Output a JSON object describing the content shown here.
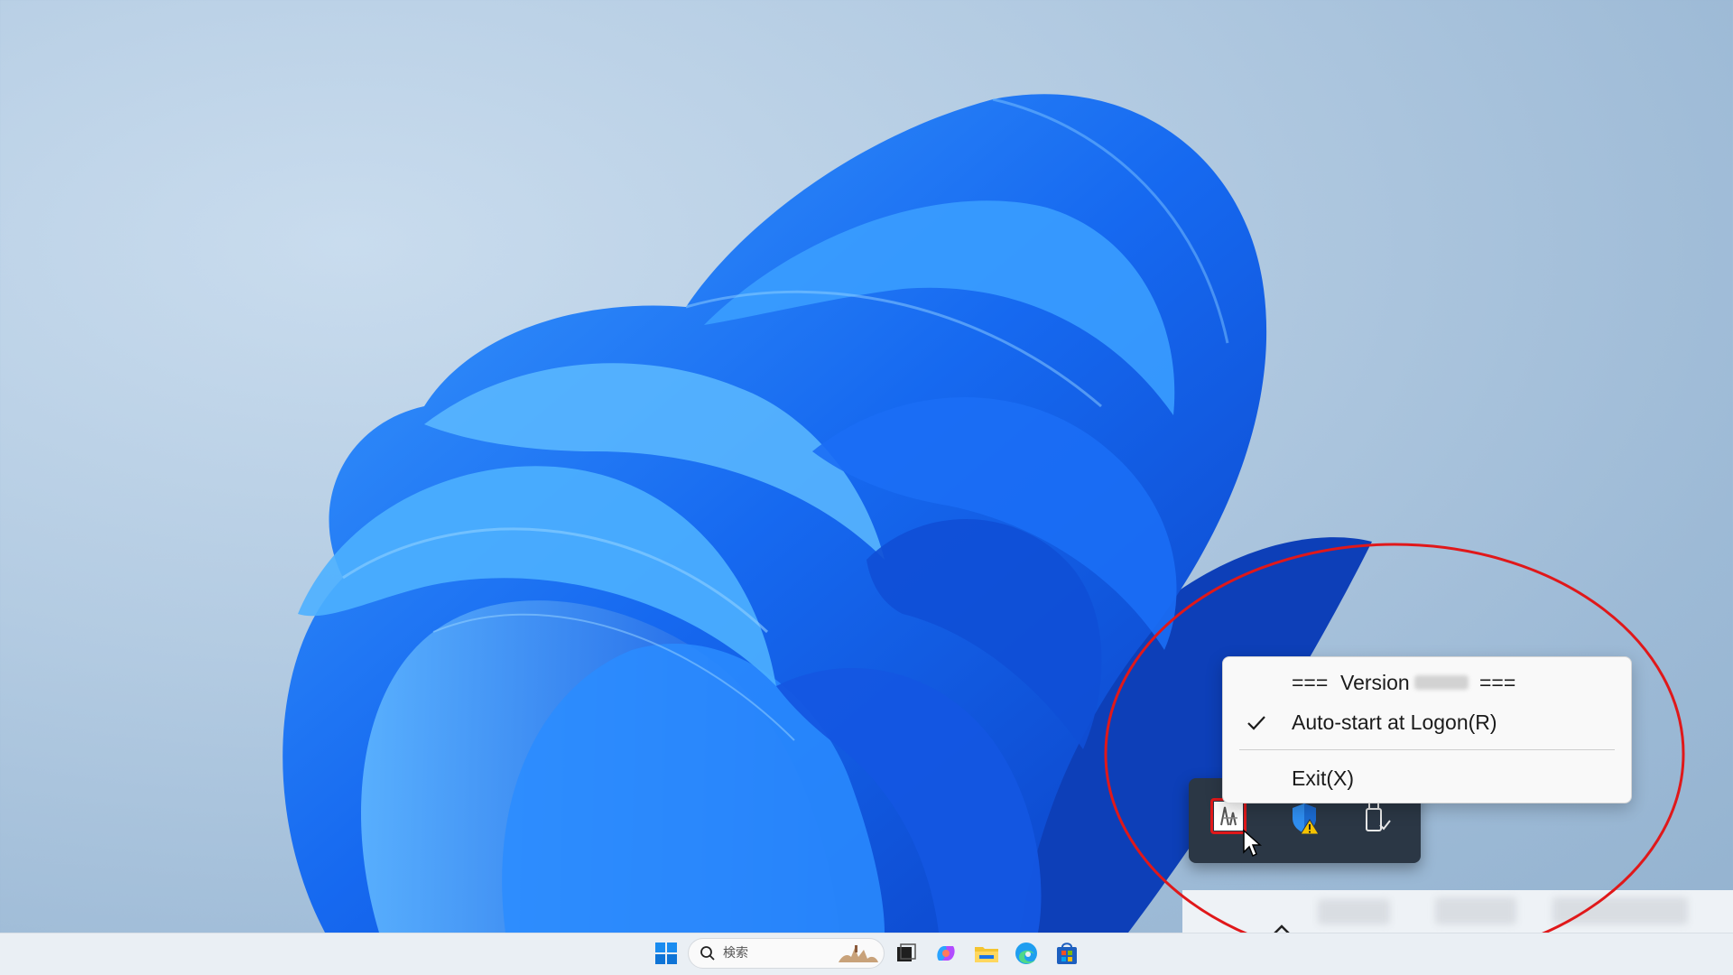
{
  "context_menu": {
    "version_prefix": "===",
    "version_word": "Version",
    "version_suffix": "===",
    "items": [
      {
        "label": "Auto-start at Logon(R)",
        "checked": true
      },
      {
        "label": "Exit(X)",
        "checked": false
      }
    ]
  },
  "tray_flyout": {
    "icons": [
      "app-tray-icon",
      "security-warning-icon",
      "usb-safely-remove-icon"
    ],
    "highlighted_icon": "app-tray-icon"
  },
  "taskbar": {
    "search_placeholder": "検索",
    "apps": [
      "start-icon",
      "search-input",
      "task-view-icon",
      "copilot-icon",
      "file-explorer-icon",
      "edge-icon",
      "store-icon"
    ]
  },
  "colors": {
    "annotation": "#e0181a",
    "flyout_bg": "#2b3745",
    "menu_bg": "#f9f9f9"
  }
}
